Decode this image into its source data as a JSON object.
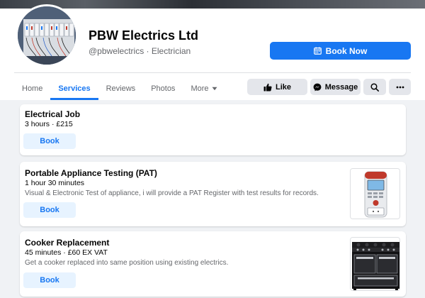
{
  "page": {
    "name": "PBW Electrics Ltd",
    "subtitle": "@pbwelectrics · Electrician",
    "book_now_label": "Book Now"
  },
  "tabs": [
    {
      "label": "Home"
    },
    {
      "label": "Services",
      "active": true
    },
    {
      "label": "Reviews"
    },
    {
      "label": "Photos"
    },
    {
      "label": "More"
    }
  ],
  "actions": {
    "like_label": "Like",
    "message_label": "Message"
  },
  "services": [
    {
      "title": "Electrical Job",
      "meta": "3 hours · £215",
      "description": "",
      "book_label": "Book",
      "image": ""
    },
    {
      "title": "Portable Appliance Testing (PAT)",
      "meta": "1 hour 30 minutes",
      "description": "Visual & Electronic Test of appliance, i will provide a PAT Register with test results for records.",
      "book_label": "Book",
      "image": "pat-tester-photo"
    },
    {
      "title": "Cooker Replacement",
      "meta": "45 minutes · £60 EX VAT",
      "description": "Get a cooker replaced into same position using existing electrics.",
      "book_label": "Book",
      "image": "range-cooker-photo"
    }
  ],
  "colors": {
    "accent": "#1877f2",
    "book_button_bg": "#e7f3ff",
    "page_bg": "#f0f2f5",
    "secondary_text": "#65676b"
  }
}
